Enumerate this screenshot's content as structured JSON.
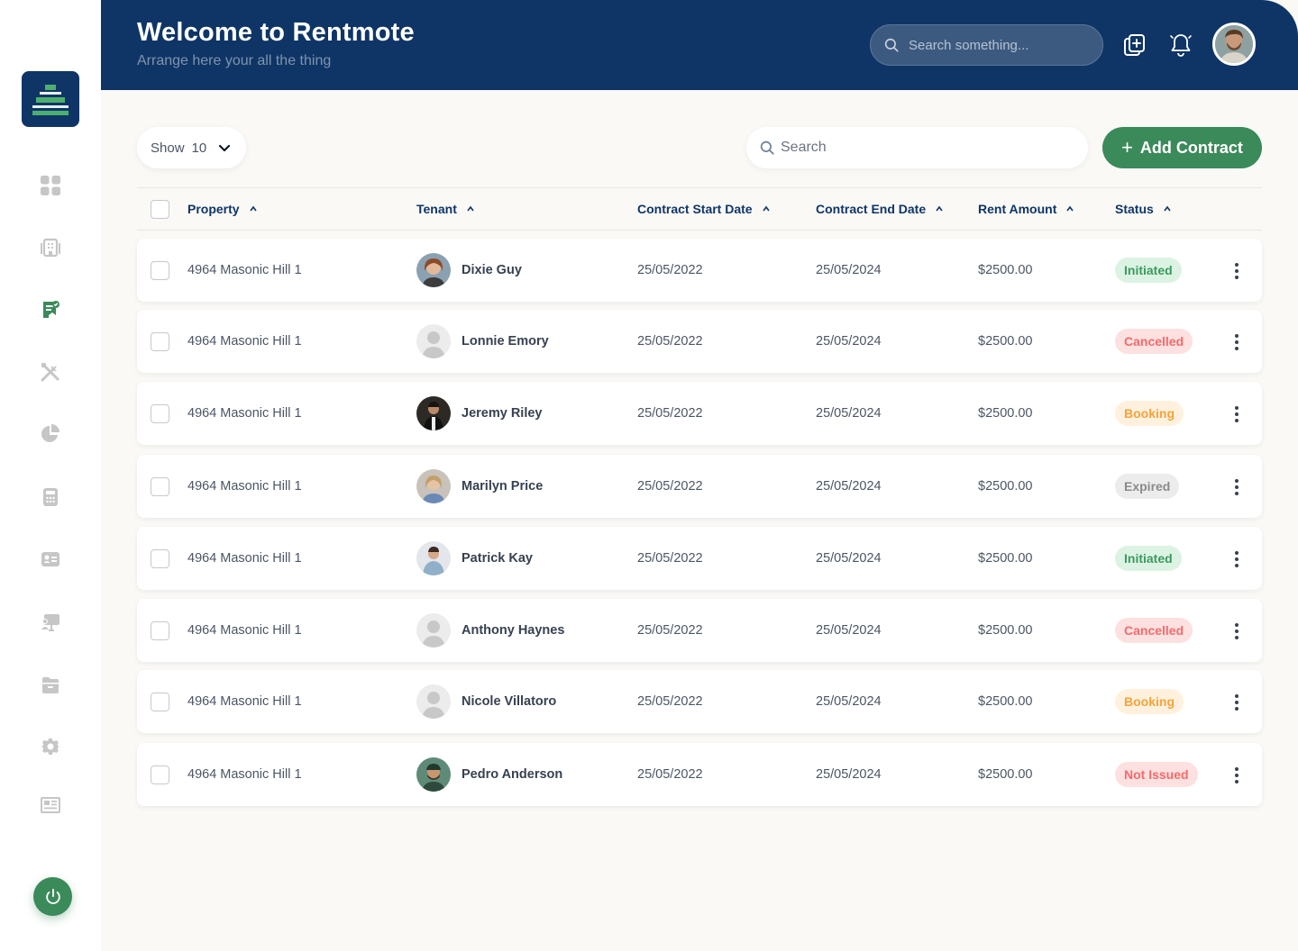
{
  "header": {
    "title": "Welcome to Rentmote",
    "subtitle": "Arrange here your all the thing",
    "search_placeholder": "Search something..."
  },
  "sidebar": {
    "items": [
      "dashboard-icon",
      "building-icon",
      "contract-icon",
      "tools-icon",
      "pie-chart-icon",
      "calculator-icon",
      "id-card-icon",
      "presentation-icon",
      "folder-icon",
      "gear-icon",
      "newspaper-icon"
    ],
    "active_index": 2
  },
  "controls": {
    "show_label": "Show",
    "show_value": "10",
    "search_placeholder": "Search",
    "add_label": "Add Contract"
  },
  "columns": [
    "Property",
    "Tenant",
    "Contract Start Date",
    "Contract End Date",
    "Rent Amount",
    "Status"
  ],
  "rows": [
    {
      "property": "4964 Masonic Hill 1",
      "tenant": "Dixie Guy",
      "start": "25/05/2022",
      "end": "25/05/2024",
      "rent": "$2500.00",
      "status": "Initiated"
    },
    {
      "property": "4964 Masonic Hill 1",
      "tenant": "Lonnie Emory",
      "start": "25/05/2022",
      "end": "25/05/2024",
      "rent": "$2500.00",
      "status": "Cancelled"
    },
    {
      "property": "4964 Masonic Hill 1",
      "tenant": "Jeremy Riley",
      "start": "25/05/2022",
      "end": "25/05/2024",
      "rent": "$2500.00",
      "status": "Booking"
    },
    {
      "property": "4964 Masonic Hill 1",
      "tenant": "Marilyn Price",
      "start": "25/05/2022",
      "end": "25/05/2024",
      "rent": "$2500.00",
      "status": "Expired"
    },
    {
      "property": "4964 Masonic Hill 1",
      "tenant": "Patrick Kay",
      "start": "25/05/2022",
      "end": "25/05/2024",
      "rent": "$2500.00",
      "status": "Initiated"
    },
    {
      "property": "4964 Masonic Hill 1",
      "tenant": "Anthony Haynes",
      "start": "25/05/2022",
      "end": "25/05/2024",
      "rent": "$2500.00",
      "status": "Cancelled"
    },
    {
      "property": "4964 Masonic Hill 1",
      "tenant": "Nicole Villatoro",
      "start": "25/05/2022",
      "end": "25/05/2024",
      "rent": "$2500.00",
      "status": "Booking"
    },
    {
      "property": "4964 Masonic Hill 1",
      "tenant": "Pedro Anderson",
      "start": "25/05/2022",
      "end": "25/05/2024",
      "rent": "$2500.00",
      "status": "Not Issued"
    }
  ],
  "colors": {
    "navy": "#0f3566",
    "green": "#3b8a5a",
    "initiated_bg": "#dcf3e3",
    "initiated_fg": "#3b9a5e",
    "cancelled_bg": "#fde0e0",
    "cancelled_fg": "#f26b6b",
    "booking_bg": "#fff1dd",
    "booking_fg": "#f5a23a",
    "expired_bg": "#ececec",
    "expired_fg": "#8a8a8a",
    "notissued_bg": "#fde0e0",
    "notissued_fg": "#f26b6b"
  }
}
